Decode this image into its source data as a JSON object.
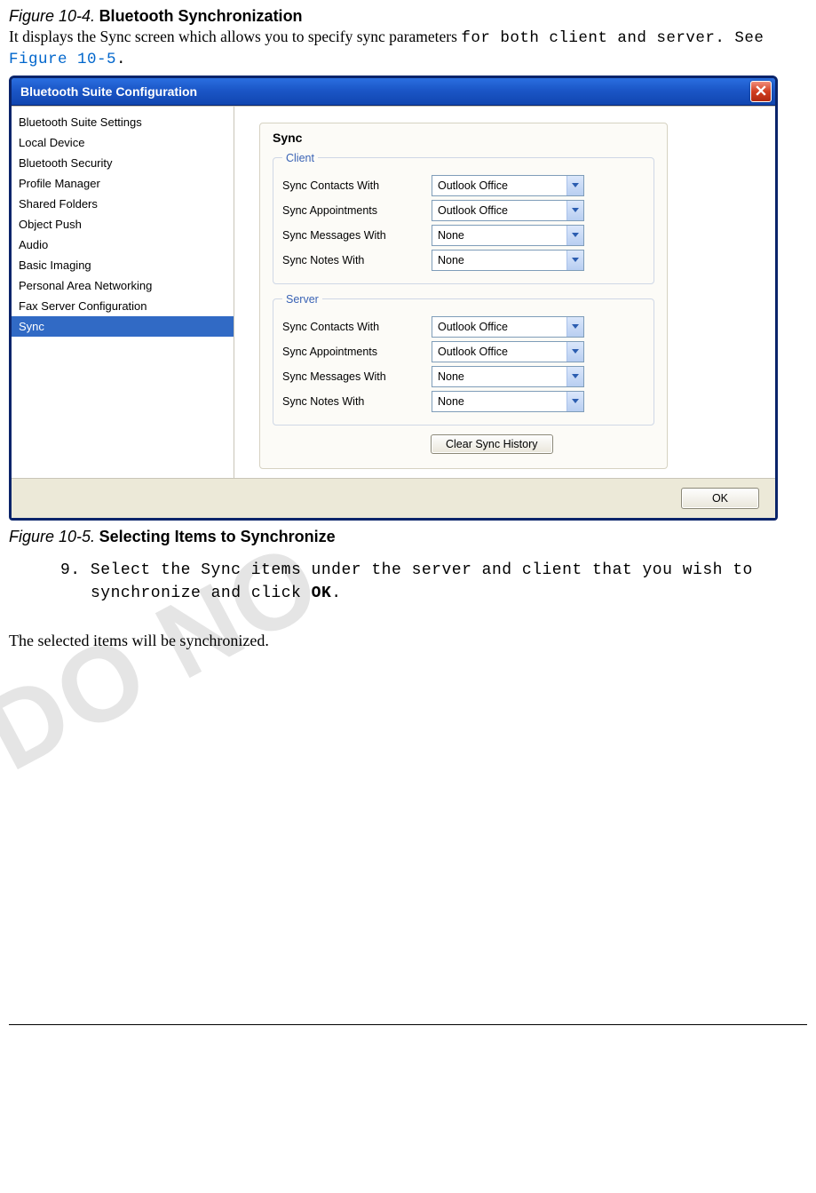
{
  "watermark": "DO NO",
  "fig104": {
    "label": "Figure 10-4.",
    "title": "Bluetooth Synchronization"
  },
  "intro": {
    "serif": "It displays the Sync screen which allows you to specify sync parameters ",
    "mono_a": "for both client and server. See ",
    "xref": "Figure 10-5",
    "mono_b": "."
  },
  "window": {
    "title": "Bluetooth Suite Configuration",
    "sidebar": [
      "Bluetooth Suite Settings",
      "Local Device",
      "Bluetooth Security",
      "Profile Manager",
      "Shared Folders",
      "Object Push",
      "Audio",
      "Basic Imaging",
      "Personal Area Networking",
      "Fax Server Configuration",
      "Sync"
    ],
    "selected_index": 10,
    "panel_title": "Sync",
    "client": {
      "legend": "Client",
      "rows": [
        {
          "label": "Sync Contacts With",
          "value": "Outlook Office"
        },
        {
          "label": "Sync Appointments",
          "value": "Outlook Office"
        },
        {
          "label": "Sync Messages With",
          "value": "None"
        },
        {
          "label": "Sync Notes With",
          "value": "None"
        }
      ]
    },
    "server": {
      "legend": "Server",
      "rows": [
        {
          "label": "Sync Contacts With",
          "value": "Outlook Office"
        },
        {
          "label": "Sync Appointments",
          "value": "Outlook Office"
        },
        {
          "label": "Sync Messages With",
          "value": "None"
        },
        {
          "label": "Sync Notes With",
          "value": "None"
        }
      ]
    },
    "clear_button": "Clear Sync History",
    "ok_button": "OK"
  },
  "fig105": {
    "label": "Figure 10-5.",
    "title": "Selecting Items to Synchronize"
  },
  "step9": {
    "num": "9.",
    "text_a": " Select the Sync items under the server and client that you wish to synchronize and click ",
    "bold": "OK",
    "text_b": "."
  },
  "result": "The selected items will be synchronized."
}
